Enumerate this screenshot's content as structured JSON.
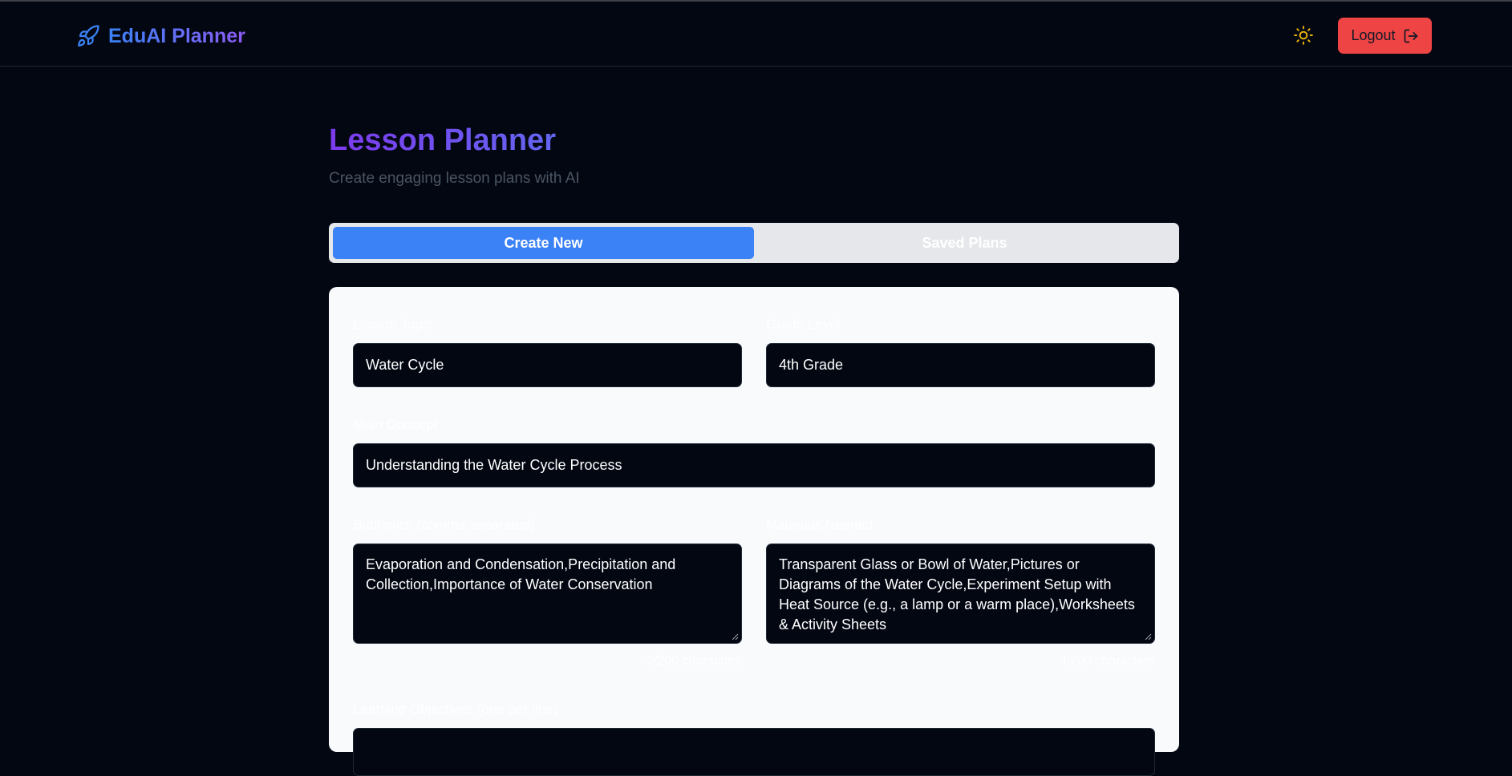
{
  "app": {
    "name": "EduAI Planner",
    "logo_icon": "rocket-icon",
    "theme_icon": "sun-icon",
    "logout_label": "Logout",
    "logout_icon": "logout-icon"
  },
  "page": {
    "title": "Lesson Planner",
    "subtitle": "Create engaging lesson plans with AI"
  },
  "tabs": [
    {
      "label": "Create New",
      "active": true
    },
    {
      "label": "Saved Plans",
      "active": false
    }
  ],
  "form": {
    "lesson_topic": {
      "label": "Lesson Topic",
      "value": "Water Cycle"
    },
    "grade_level": {
      "label": "Grade Level",
      "value": "4th Grade"
    },
    "main_concept": {
      "label": "Main Concept",
      "value": "Understanding the Water Cycle Process"
    },
    "subtopics": {
      "label": "Subtopics (comma separated)",
      "value": "Evaporation and Condensation,Precipitation and Collection,Importance of Water Conservation",
      "counter": "3/200 characters"
    },
    "materials": {
      "label": "Materials Needed",
      "value": "Transparent Glass or Bowl of Water,Pictures or Diagrams of the Water Cycle,Experiment Setup with Heat Source (e.g., a lamp or a warm place),Worksheets & Activity Sheets",
      "counter": "4/200 characters"
    },
    "learning_objectives": {
      "label": "Learning Objectives (one per line)"
    }
  },
  "colors": {
    "background": "#030712",
    "accent": "#3b82f6",
    "danger": "#ef4444",
    "card": "#f8fafc",
    "theme_icon": "#eab308"
  }
}
